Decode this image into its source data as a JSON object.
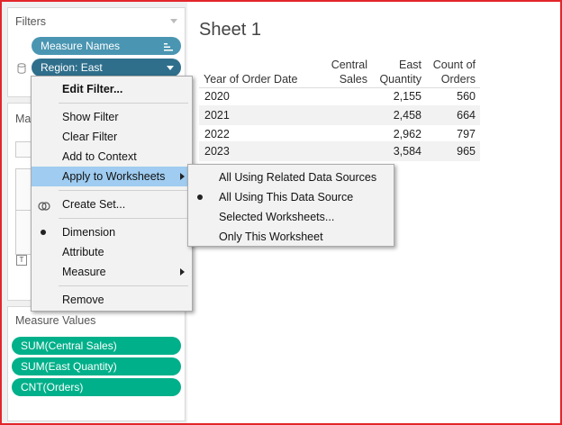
{
  "filters": {
    "title": "Filters",
    "pills": [
      {
        "label": "Measure Names"
      },
      {
        "label": "Region: East"
      }
    ]
  },
  "marks": {
    "title_partial": "Ma"
  },
  "measure_values": {
    "title": "Measure Values",
    "pills": [
      {
        "label": "SUM(Central Sales)"
      },
      {
        "label": "SUM(East Quantity)"
      },
      {
        "label": "CNT(Orders)"
      }
    ]
  },
  "sheet": {
    "title": "Sheet 1",
    "row_header": "Year of Order Date",
    "col_headers": [
      {
        "line1": "Central",
        "line2": "Sales"
      },
      {
        "line1": "East",
        "line2": "Quantity"
      },
      {
        "line1": "Count of",
        "line2": "Orders"
      }
    ],
    "rows": [
      {
        "year": "2020",
        "central": "",
        "east": "2,155",
        "count": "560"
      },
      {
        "year": "2021",
        "central": "",
        "east": "2,458",
        "count": "664"
      },
      {
        "year": "2022",
        "central": "",
        "east": "2,962",
        "count": "797"
      },
      {
        "year": "2023",
        "central": "",
        "east": "3,584",
        "count": "965"
      }
    ]
  },
  "context_menu": {
    "items": [
      {
        "label": "Edit Filter..."
      },
      {
        "label": "Show Filter"
      },
      {
        "label": "Clear Filter"
      },
      {
        "label": "Add to Context"
      },
      {
        "label": "Apply to Worksheets"
      },
      {
        "label": "Create Set..."
      },
      {
        "label": "Dimension"
      },
      {
        "label": "Attribute"
      },
      {
        "label": "Measure"
      },
      {
        "label": "Remove"
      }
    ]
  },
  "submenu": {
    "items": [
      {
        "label": "All Using Related Data Sources"
      },
      {
        "label": "All Using This Data Source"
      },
      {
        "label": "Selected Worksheets..."
      },
      {
        "label": "Only This Worksheet"
      }
    ]
  },
  "colors": {
    "pill_blue": "#4a96b2",
    "pill_green": "#00b08a",
    "menu_highlight": "#9fccf0",
    "frame_border": "#e3262b"
  },
  "icons": [
    "list-sort-icon",
    "database-icon",
    "dropdown-arrow-icon",
    "create-set-icon",
    "submenu-arrow-icon",
    "radio-dot-icon"
  ]
}
